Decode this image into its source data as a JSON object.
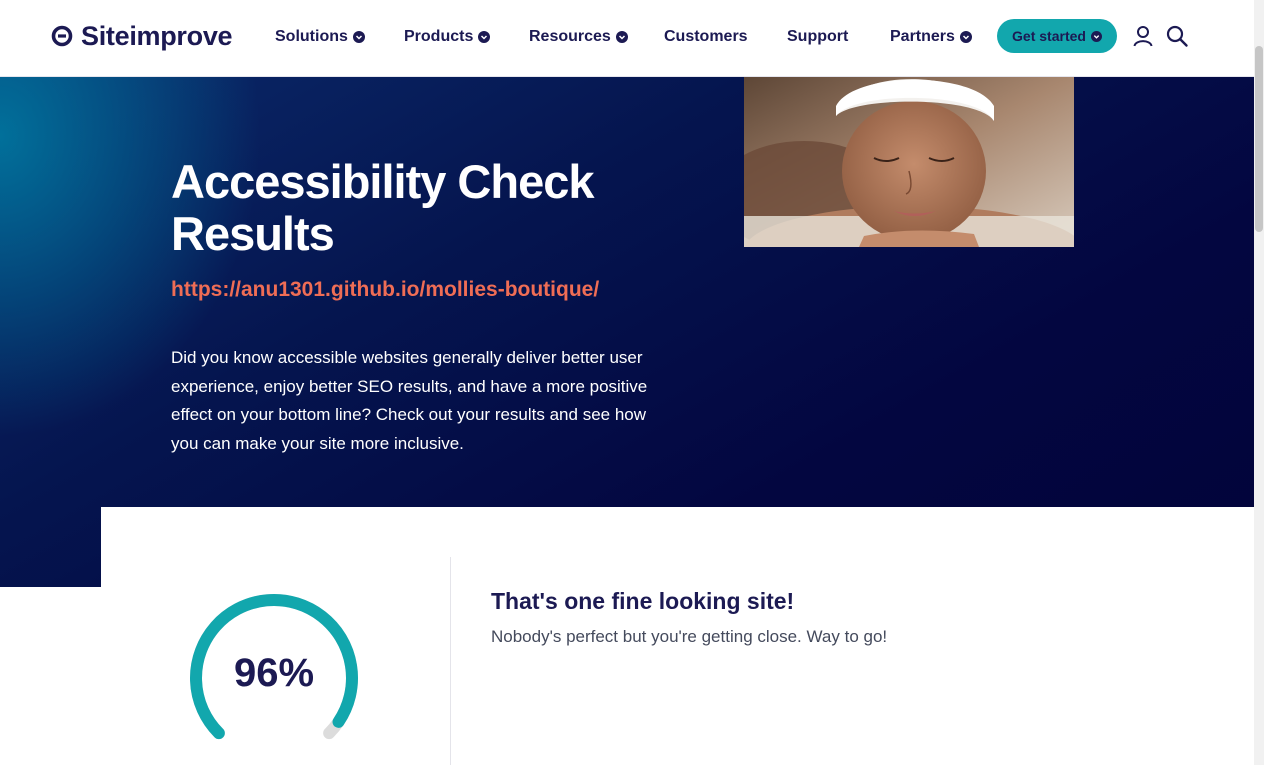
{
  "brand": {
    "name": "Siteimprove",
    "color": "#1c1a53",
    "accent": "#12a7ad",
    "url_color": "#ef6d55"
  },
  "nav": {
    "items": [
      {
        "label": "Solutions",
        "has_menu": true
      },
      {
        "label": "Products",
        "has_menu": true
      },
      {
        "label": "Resources",
        "has_menu": true
      },
      {
        "label": "Customers",
        "has_menu": false
      },
      {
        "label": "Support",
        "has_menu": false
      },
      {
        "label": "Partners",
        "has_menu": true
      }
    ],
    "cta_label": "Get started",
    "account_icon": "user-icon",
    "search_icon": "search-icon"
  },
  "hero": {
    "title": "Accessibility Check Results",
    "url": "https://anu1301.github.io/mollies-boutique/",
    "description": "Did you know accessible websites generally deliver better user experience, enjoy better SEO results, and have a more positive effect on your bottom line? Check out your results and see how you can make your site more inclusive."
  },
  "result": {
    "score_label": "96%",
    "score": 96,
    "title": "That's one fine looking site!",
    "message": "Nobody's perfect but you're getting close. Way to go!"
  }
}
